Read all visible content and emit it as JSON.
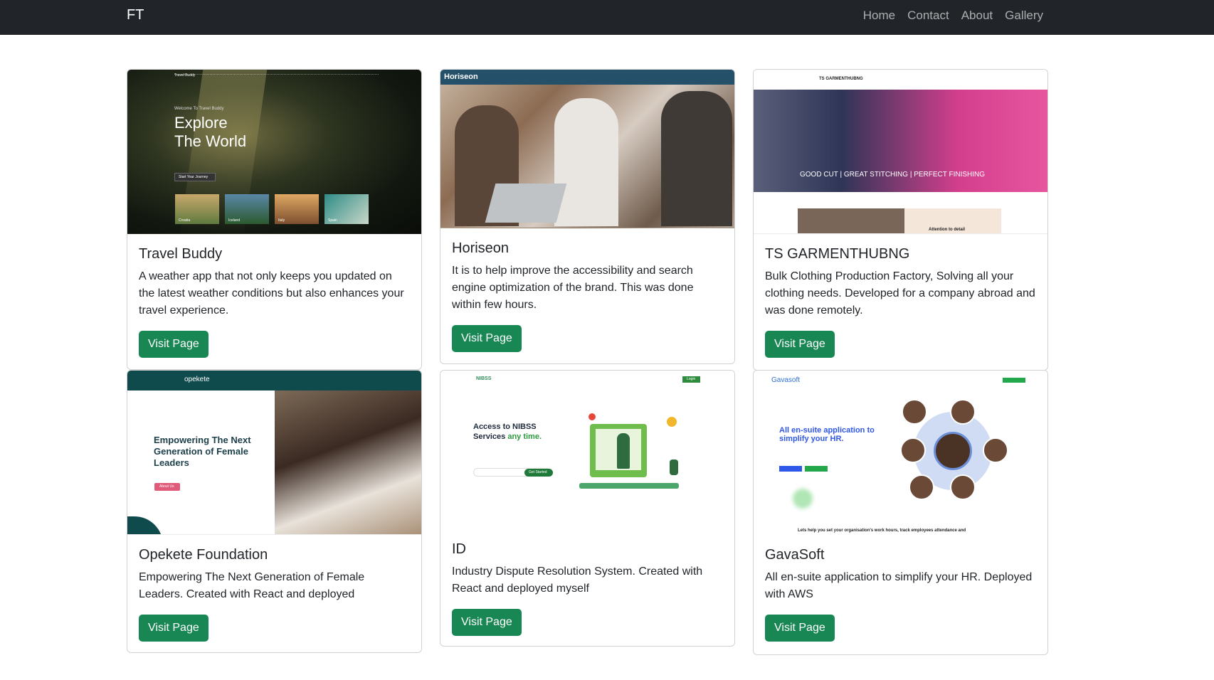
{
  "navbar": {
    "brand": "FT",
    "links": [
      "Home",
      "Contact",
      "About",
      "Gallery"
    ]
  },
  "thumbnails": {
    "travel_buddy": {
      "nav_brand": "Travel Buddy",
      "kicker": "Welcome To Travel Buddy",
      "title_line1": "Explore",
      "title_line2": "The World",
      "cta": "Start Your Journey",
      "places": [
        "Croatia",
        "Iceland",
        "Italy",
        "Spain"
      ]
    },
    "horiseon": {
      "logo": "Horiseon"
    },
    "ts": {
      "logo": "TS GARMENTHUBNG",
      "banner": "GOOD CUT | GREAT STITCHING | PERFECT FINISHING",
      "tagline": "Attention to detail"
    },
    "opekete": {
      "logo": "opekete",
      "headline": "Empowering The Next Generation of Female Leaders",
      "cta": "About Us"
    },
    "id": {
      "logo": "NIBSS",
      "login": "Login",
      "headline_part1": "Access to NIBSS Services ",
      "headline_accent": "any time.",
      "cta": "Get Started"
    },
    "gavasoft": {
      "logo": "Gavasoft",
      "headline": "All en-suite application to simplify your HR.",
      "footer": "Lets help you set your organisation's work hours, track employees attendance and"
    }
  },
  "cards": [
    {
      "title": "Travel Buddy",
      "text": "A weather app that not only keeps you updated on the latest weather conditions but also enhances your travel experience.",
      "button": "Visit Page"
    },
    {
      "title": "Horiseon",
      "text": "It is to help improve the accessibility and search engine optimization of the brand. This was done within few hours.",
      "button": "Visit Page"
    },
    {
      "title": "TS GARMENTHUBNG",
      "text": "Bulk Clothing Production Factory, Solving all your clothing needs. Developed for a company abroad and was done remotely.",
      "button": "Visit Page"
    },
    {
      "title": "Opekete Foundation",
      "text": "Empowering The Next Generation of Female Leaders. Created with React and deployed",
      "button": "Visit Page"
    },
    {
      "title": "ID",
      "text": "Industry Dispute Resolution System. Created with React and deployed myself",
      "button": "Visit Page"
    },
    {
      "title": "GavaSoft",
      "text": "All en-suite application to simplify your HR. Deployed with AWS",
      "button": "Visit Page"
    }
  ],
  "colors": {
    "navbar_bg": "#212529",
    "button_bg": "#198754",
    "card_border": "rgba(0,0,0,0.175)"
  }
}
